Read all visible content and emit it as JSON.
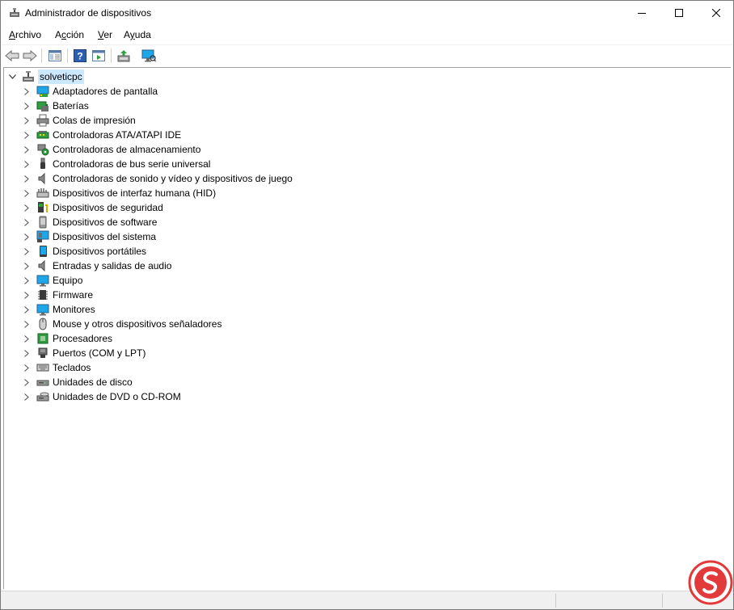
{
  "window": {
    "title": "Administrador de dispositivos",
    "controls": {
      "minimize_icon": "minimize-icon",
      "maximize_icon": "maximize-icon",
      "close_icon": "close-icon"
    }
  },
  "menu": {
    "items": [
      {
        "label": "Archivo",
        "accel": "A"
      },
      {
        "label": "Acción",
        "accel": "c"
      },
      {
        "label": "Ver",
        "accel": "V"
      },
      {
        "label": "Ayuda",
        "accel": "y"
      }
    ]
  },
  "toolbar": {
    "buttons": [
      "back-icon",
      "forward-icon",
      "properties-icon",
      "help-icon",
      "view-icon",
      "update-driver-icon",
      "scan-hardware-icon"
    ]
  },
  "tree": {
    "root": {
      "label": "solveticpc",
      "expanded": true
    },
    "items": [
      {
        "label": "Adaptadores de pantalla",
        "icon": "display-adapter-icon"
      },
      {
        "label": "Baterías",
        "icon": "battery-icon"
      },
      {
        "label": "Colas de impresión",
        "icon": "printer-icon"
      },
      {
        "label": "Controladoras ATA/ATAPI IDE",
        "icon": "ide-controller-icon"
      },
      {
        "label": "Controladoras de almacenamiento",
        "icon": "storage-controller-icon"
      },
      {
        "label": "Controladoras de bus serie universal",
        "icon": "usb-icon"
      },
      {
        "label": "Controladoras de sonido y vídeo y dispositivos de juego",
        "icon": "speaker-icon"
      },
      {
        "label": "Dispositivos de interfaz humana (HID)",
        "icon": "hid-icon"
      },
      {
        "label": "Dispositivos de seguridad",
        "icon": "security-key-icon"
      },
      {
        "label": "Dispositivos de software",
        "icon": "software-device-icon"
      },
      {
        "label": "Dispositivos del sistema",
        "icon": "system-device-icon"
      },
      {
        "label": "Dispositivos portátiles",
        "icon": "portable-device-icon"
      },
      {
        "label": "Entradas y salidas de audio",
        "icon": "audio-io-icon"
      },
      {
        "label": "Equipo",
        "icon": "computer-icon"
      },
      {
        "label": "Firmware",
        "icon": "firmware-chip-icon"
      },
      {
        "label": "Monitores",
        "icon": "monitor-icon"
      },
      {
        "label": "Mouse y otros dispositivos señaladores",
        "icon": "mouse-icon"
      },
      {
        "label": "Procesadores",
        "icon": "processor-icon"
      },
      {
        "label": "Puertos (COM y LPT)",
        "icon": "port-icon"
      },
      {
        "label": "Teclados",
        "icon": "keyboard-icon"
      },
      {
        "label": "Unidades de disco",
        "icon": "disk-drive-icon"
      },
      {
        "label": "Unidades de DVD o CD-ROM",
        "icon": "dvd-drive-icon"
      }
    ]
  },
  "colors": {
    "selection": "#cce8ff",
    "monitor_blue": "#1ea7e8",
    "accent_green": "#2e9e3e"
  }
}
